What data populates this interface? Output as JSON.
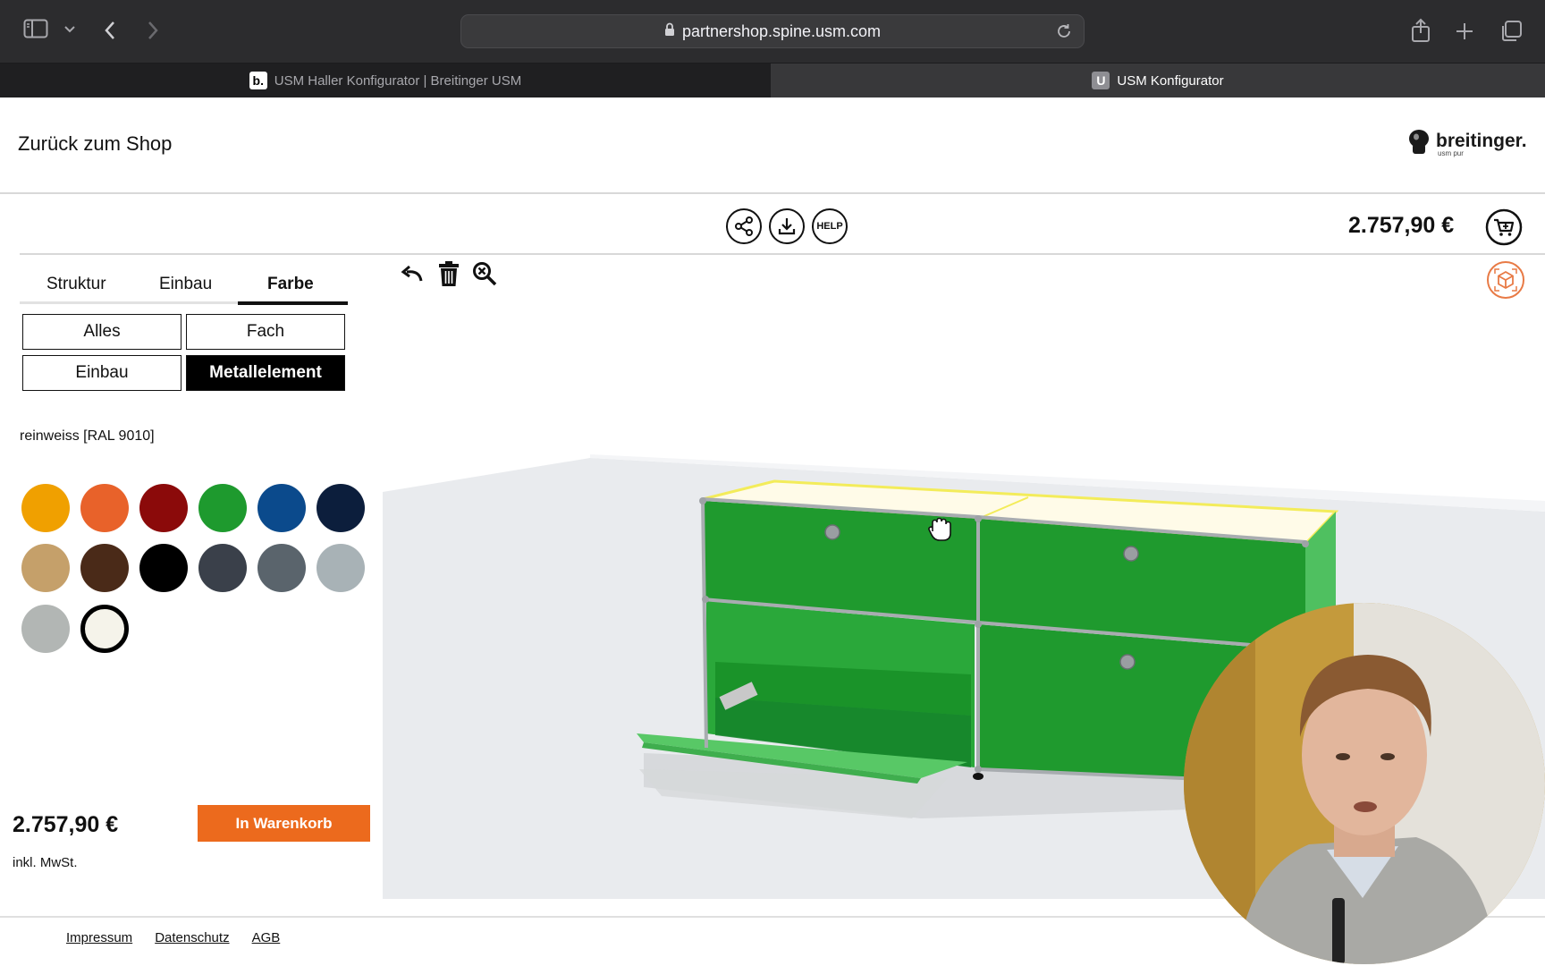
{
  "browser": {
    "url": "partnershop.spine.usm.com",
    "tabs": [
      {
        "title": "USM Haller Konfigurator | Breitinger USM",
        "favicon": "b.",
        "active": false
      },
      {
        "title": "USM Konfigurator",
        "favicon": "U",
        "active": true
      }
    ]
  },
  "header": {
    "back_label": "Zurück zum Shop",
    "logo_name": "breitinger.",
    "logo_sub": "usm pur"
  },
  "actions": {
    "help_label": "HELP",
    "price": "2.757,90 €"
  },
  "config": {
    "tabs": [
      {
        "label": "Struktur",
        "selected": false
      },
      {
        "label": "Einbau",
        "selected": false
      },
      {
        "label": "Farbe",
        "selected": true
      }
    ],
    "filters": [
      {
        "label": "Alles",
        "selected": false
      },
      {
        "label": "Fach",
        "selected": false
      },
      {
        "label": "Einbau",
        "selected": false
      },
      {
        "label": "Metallelement",
        "selected": true
      }
    ],
    "selected_color_name": "reinweiss [RAL 9010]",
    "swatches": [
      {
        "color": "#f0a000",
        "selected": false
      },
      {
        "color": "#e8622a",
        "selected": false
      },
      {
        "color": "#8b0a0a",
        "selected": false
      },
      {
        "color": "#1e9a2e",
        "selected": false
      },
      {
        "color": "#0b4a8c",
        "selected": false
      },
      {
        "color": "#0c1e3c",
        "selected": false
      },
      {
        "color": "#c5a06a",
        "selected": false
      },
      {
        "color": "#4a2a18",
        "selected": false
      },
      {
        "color": "#000000",
        "selected": false
      },
      {
        "color": "#3a404a",
        "selected": false
      },
      {
        "color": "#5a646c",
        "selected": false
      },
      {
        "color": "#a8b2b6",
        "selected": false
      },
      {
        "color": "#b2b6b4",
        "selected": false
      },
      {
        "color": "#f5f3ea",
        "selected": true
      }
    ],
    "price": "2.757,90 €",
    "vat_note": "inkl. MwSt.",
    "add_to_cart": "In Warenkorb"
  },
  "footer": {
    "links": [
      "Impressum",
      "Datenschutz",
      "AGB"
    ]
  },
  "colors": {
    "accent": "#ec6a1d",
    "cabinet_green": "#1e9a2e"
  }
}
